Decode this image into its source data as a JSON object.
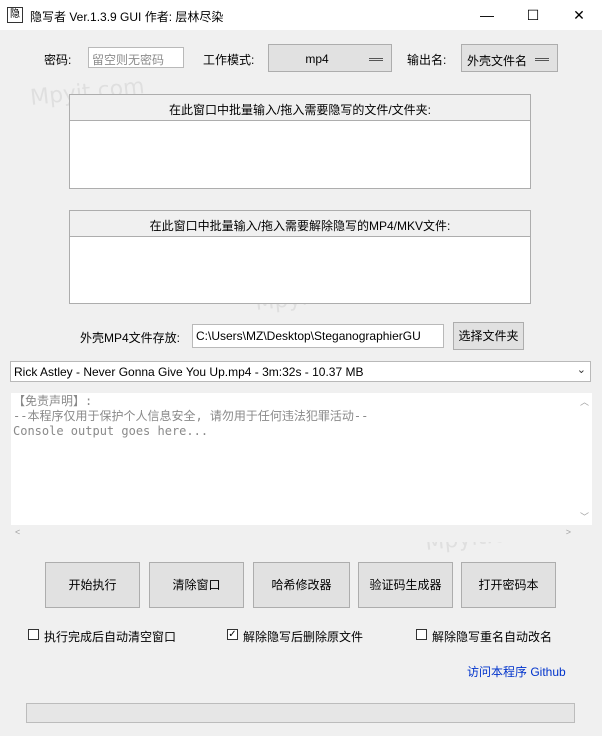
{
  "window": {
    "title": "隐写者 Ver.1.3.9 GUI 作者: 层林尽染",
    "app_icon_glyph": "隐",
    "minimize_glyph": "—",
    "maximize_glyph": "☐",
    "close_glyph": "✕"
  },
  "top_row": {
    "password_label": "密码:",
    "password_placeholder": "留空则无密码",
    "mode_label": "工作模式:",
    "mode_value": "mp4",
    "output_label": "输出名:",
    "output_value": "外壳文件名"
  },
  "hide_group": {
    "title": "在此窗口中批量输入/拖入需要隐写的文件/文件夹:"
  },
  "unhide_group": {
    "title": "在此窗口中批量输入/拖入需要解除隐写的MP4/MKV文件:"
  },
  "shell": {
    "label": "外壳MP4文件存放:",
    "path": "C:\\Users\\MZ\\Desktop\\SteganographierGU",
    "choose_button": "选择文件夹"
  },
  "selected_file": "Rick Astley - Never Gonna Give You Up.mp4 - 3m:32s - 10.37 MB",
  "console": {
    "lines": [
      "【免责声明】:",
      "--本程序仅用于保护个人信息安全, 请勿用于任何违法犯罪活动--",
      "Console output goes here..."
    ]
  },
  "actions": {
    "start": "开始执行",
    "clear": "清除窗口",
    "hash": "哈希修改器",
    "captcha": "验证码生成器",
    "password_book": "打开密码本"
  },
  "options": {
    "auto_clear": {
      "label": "执行完成后自动清空窗口",
      "checked": false
    },
    "delete_source": {
      "label": "解除隐写后删除原文件",
      "checked": true
    },
    "auto_rename": {
      "label": "解除隐写重名自动改名",
      "checked": false
    }
  },
  "github_link": "访问本程序 Github",
  "progress": 0,
  "watermark": "Mpyit.com"
}
